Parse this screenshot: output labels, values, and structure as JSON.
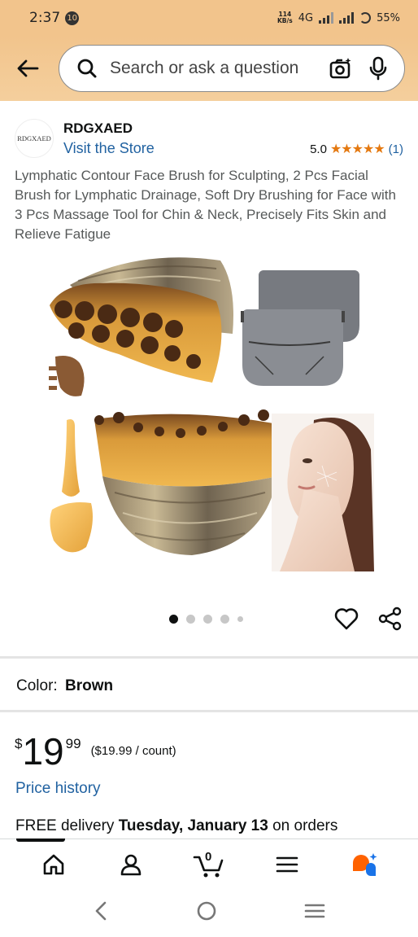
{
  "status_bar": {
    "time": "2:37",
    "notification_count": "10",
    "speed_value": "114",
    "speed_unit": "KB/s",
    "network": "4G",
    "battery": "55%"
  },
  "search": {
    "placeholder": "Search or ask a question"
  },
  "brand": {
    "logo_text": "RDGXAED",
    "name": "RDGXAED",
    "visit_store": "Visit the Store",
    "rating": "5.0",
    "stars": "★★★★★",
    "review_count": "(1)"
  },
  "product": {
    "title": "Lymphatic Contour Face Brush for Sculpting, 2 Pcs Facial Brush for Lymphatic Drainage, Soft Dry Brushing for Face with 3 Pcs Massage Tool for Chin & Neck, Precisely Fits Skin and Relieve Fatigue",
    "image_count": 5,
    "active_image_index": 0
  },
  "color": {
    "label": "Color:",
    "value": "Brown"
  },
  "price": {
    "currency": "$",
    "whole": "19",
    "fraction": "99",
    "unit_price": "($19.99 / count)",
    "history_link": "Price history"
  },
  "delivery": {
    "prefix": "FREE delivery",
    "date": "Tuesday, January 13",
    "suffix": "on orders"
  },
  "tab_bar": {
    "cart_count": "0",
    "items": [
      "home-icon",
      "account-icon",
      "cart-icon",
      "menu-icon",
      "rufus-icon"
    ]
  },
  "colors": {
    "header_bg": "#f2c48c",
    "link": "#2162a1",
    "star": "#e47911",
    "rufus_orange": "#ff6200",
    "rufus_blue": "#1a73e8"
  }
}
